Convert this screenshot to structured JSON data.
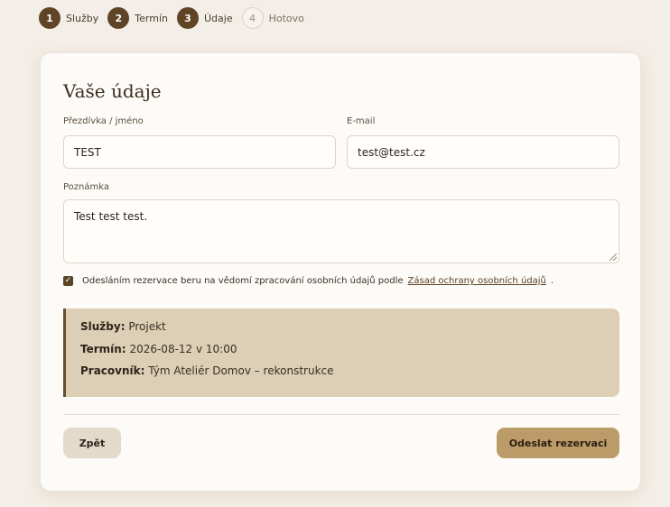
{
  "stepper": {
    "steps": [
      {
        "number": "1",
        "label": "Služby",
        "state": "done"
      },
      {
        "number": "2",
        "label": "Termín",
        "state": "done"
      },
      {
        "number": "3",
        "label": "Údaje",
        "state": "active"
      },
      {
        "number": "4",
        "label": "Hotovo",
        "state": "pending"
      }
    ]
  },
  "form": {
    "title": "Vaše údaje",
    "name_label": "Přezdívka / jméno",
    "name_value": "TEST",
    "email_label": "E-mail",
    "email_value": "test@test.cz",
    "note_label": "Poznámka",
    "note_value": "Test test test.",
    "consent_text": "Odesláním rezervace beru na vědomí zpracování osobních údajů podle",
    "consent_link": "Zásad ochrany osobních údajů",
    "consent_suffix": ".",
    "consent_checked": true
  },
  "summary": {
    "services_label": "Služby:",
    "services_value": "Projekt",
    "date_label": "Termín:",
    "date_value": "2026-08-12 v 10:00",
    "worker_label": "Pracovník:",
    "worker_value": "Tým Ateliér Domov – rekonstrukce"
  },
  "actions": {
    "back_label": "Zpět",
    "submit_label": "Odeslat rezervaci"
  },
  "colors": {
    "accent": "#5f4526",
    "summary_bg": "#dccfb5",
    "submit_bg": "#bb9b68",
    "page_bg": "#f3eee7"
  }
}
